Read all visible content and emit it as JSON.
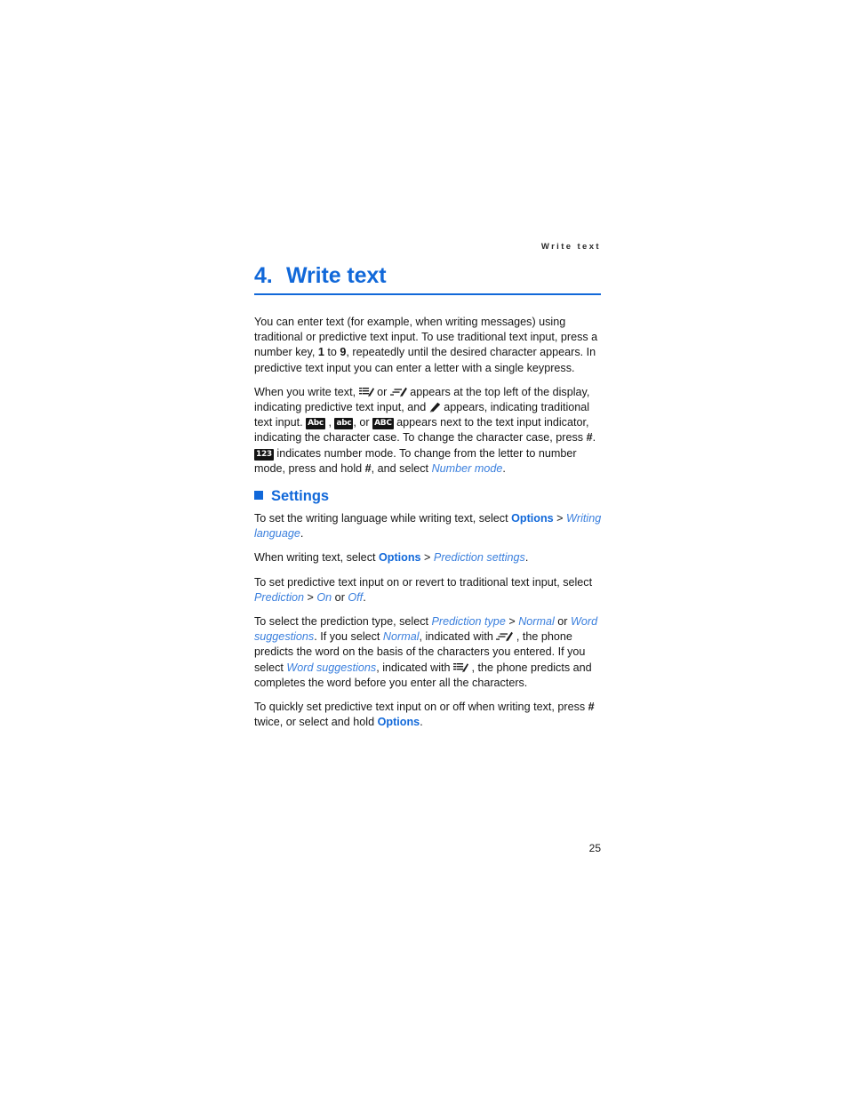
{
  "page": {
    "running_header": "Write text",
    "folio": "25",
    "accent_color": "#1168d9",
    "italic_link_color": "#3a7fdd",
    "text_color": "#161616",
    "badge_bg": "#141414",
    "badge_fg": "#ffffff"
  },
  "chapter": {
    "number": "4.",
    "title": "Write text"
  },
  "intro": {
    "p1_a": "You can enter text (for example, when writing messages) using traditional or predictive text input. To use traditional text input, press a number key, ",
    "p1_key1": "1",
    "p1_b": " to ",
    "p1_key9": "9",
    "p1_c": ", repeatedly until the desired character appears. In predictive text input you can enter a letter with a single keypress."
  },
  "indicators": {
    "t1": "When you write text, ",
    "icon_word_suggestions": "pen-lines-icon",
    "t2": " or ",
    "icon_normal_prediction": "pen-dashes-icon",
    "t3": " appears at the top left of the display, indicating predictive text input, and ",
    "icon_traditional": "pen-icon",
    "t4": " appears, indicating traditional text input. ",
    "badge_abc_mixed": "Abc",
    "t5": " , ",
    "badge_abc_lower": "abc",
    "t6": ", or ",
    "badge_abc_upper": "ABC",
    "t7": " appears next to the text input indicator, indicating the character case. To change the character case, press ",
    "hash1": "#",
    "t8": ". ",
    "badge_123": "123",
    "t9": " indicates number mode. To change from the letter to number mode, press and hold ",
    "hash2": "#",
    "t10": ", and select ",
    "link_number_mode": "Number mode",
    "t11": "."
  },
  "settings": {
    "heading": "Settings",
    "p1": {
      "a": "To set the writing language while writing text, select ",
      "options": "Options",
      "gt": " > ",
      "writing_language": "Writing language",
      "end": "."
    },
    "p2": {
      "a": "When writing text, select ",
      "options": "Options",
      "gt": " > ",
      "prediction_settings": "Prediction settings",
      "end": "."
    },
    "p3": {
      "a": "To set predictive text input on or revert to traditional text input, select ",
      "prediction": "Prediction",
      "gt": " > ",
      "on": "On",
      "or": " or ",
      "off": "Off",
      "end": "."
    },
    "p4": {
      "a": "To select the prediction type, select ",
      "prediction_type": "Prediction type",
      "gt": " > ",
      "normal": "Normal",
      "or1": " or ",
      "word_suggestions": "Word suggestions",
      "b": ". If you select ",
      "normal2": "Normal",
      "c": ", indicated with ",
      "icon_normal": "pen-dashes-icon",
      "d": " , the phone predicts the word on the basis of the characters you entered. If you select ",
      "word_suggestions2": "Word suggestions",
      "e": ", indicated with ",
      "icon_word": "pen-lines-icon",
      "f": " , the phone predicts and completes the word before you enter all the characters."
    },
    "p5": {
      "a": "To quickly set predictive text input on or off when writing text, press ",
      "hash": "#",
      "b": " twice, or select and hold ",
      "options": "Options",
      "end": "."
    }
  }
}
